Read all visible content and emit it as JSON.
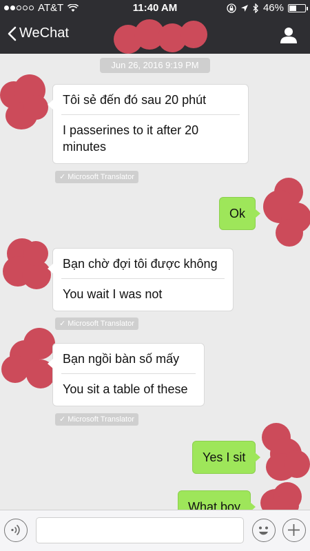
{
  "status_bar": {
    "carrier": "AT&T",
    "time": "11:40 AM",
    "battery": "46%",
    "battery_level": 0.46,
    "signal_dots_filled": 2,
    "signal_dots_total": 5,
    "icons": [
      "wifi-icon",
      "lock-rotation-icon",
      "location-arrow-icon",
      "bluetooth-icon"
    ]
  },
  "nav": {
    "back_label": "WeChat",
    "contact_icon": "person-icon"
  },
  "chat": {
    "timestamp": "Jun 26, 2016 9:19 PM",
    "translator_label": "Microsoft Translator",
    "messages": [
      {
        "direction": "in",
        "original": "Tôi sẻ đến đó sau 20 phút",
        "translation": "I passerines to it after 20 minutes"
      },
      {
        "direction": "out",
        "text": "Ok"
      },
      {
        "direction": "in",
        "original": "Bạn chờ đợi tôi được không",
        "translation": "You wait I was not"
      },
      {
        "direction": "in",
        "original": "Bạn ngồi bàn số mấy",
        "translation": "You sit a table of these"
      },
      {
        "direction": "out",
        "text": "Yes I sit"
      },
      {
        "direction": "out",
        "text": "What boy"
      }
    ]
  },
  "input_bar": {
    "voice_icon": "voice-icon",
    "emoji_icon": "emoji-icon",
    "plus_icon": "plus-icon",
    "input_value": ""
  },
  "colors": {
    "header_bg": "#2e2e32",
    "chat_bg": "#ebebeb",
    "outgoing_bubble": "#9ee65a",
    "incoming_bubble": "#ffffff",
    "redaction": "#cc4b5a"
  }
}
